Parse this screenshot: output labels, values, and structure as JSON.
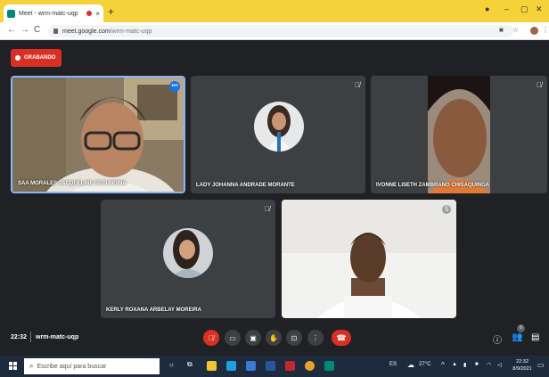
{
  "browser": {
    "tab_title": "Meet - wrm-matc-uqp",
    "new_tab_symbol": "+",
    "tab_close_symbol": "×",
    "window_controls": [
      "●",
      "–",
      "▢",
      "✕"
    ],
    "url_domain": "meet.google.com",
    "url_path": "/wrm-matc-uqp",
    "icons": [
      "back-icon",
      "forward-icon",
      "reload-icon",
      "lock-icon",
      "camera-permission-icon",
      "star-icon",
      "profile-icon",
      "menu-icon"
    ]
  },
  "recording": {
    "label": "GRABANDO"
  },
  "participants": [
    {
      "name": "SAA MORALES JACQUELINE SECUNDINA",
      "active_speaker": true
    },
    {
      "name": "LADY JOHANNA ANDRADE MORANTE",
      "muted": true
    },
    {
      "name": "IVONNE LISETH ZAMBRANO CHISAQUINGA",
      "muted": true
    },
    {
      "name": "KERLY ROXANA ARBELAY MOREIRA",
      "muted": true
    },
    {
      "name": "",
      "muted": true
    }
  ],
  "meeting": {
    "time": "22:32",
    "code": "wrm-matc-uqp",
    "participant_count": "6"
  },
  "controls": [
    {
      "name": "mic-toggle",
      "icon": "mic-off-icon",
      "active": "red"
    },
    {
      "name": "captions",
      "icon": "captions-icon"
    },
    {
      "name": "camera-toggle",
      "icon": "camera-icon"
    },
    {
      "name": "raise-hand",
      "icon": "hand-icon"
    },
    {
      "name": "present",
      "icon": "present-icon"
    },
    {
      "name": "more-options",
      "icon": "more-icon"
    },
    {
      "name": "leave-call",
      "icon": "hangup-icon"
    }
  ],
  "taskbar": {
    "search_placeholder": "Escribe aquí para buscar",
    "weather": "27°C",
    "language": "ES",
    "clock_time": "22:32",
    "clock_date": "8/9/2021"
  },
  "colors": {
    "tab_bar": "#f6d23a",
    "meet_bg": "#202124",
    "tile_bg": "#3c4043",
    "recording_red": "#d93025",
    "taskbar": "#1e2b3c"
  }
}
